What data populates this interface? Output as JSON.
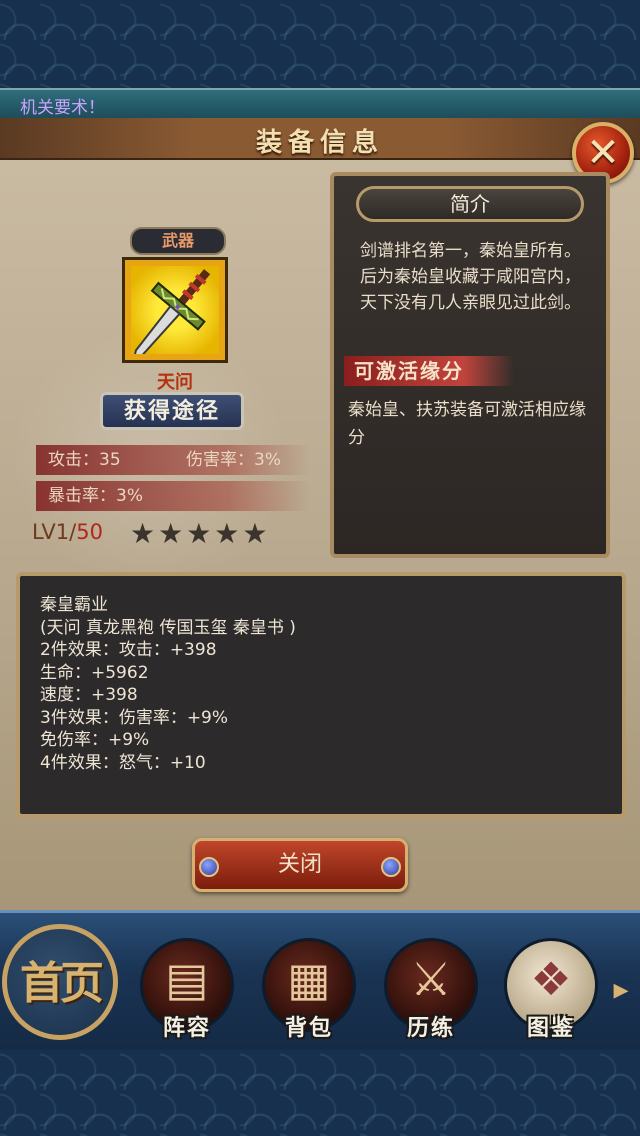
{
  "ticker": {
    "text": "机关要术！"
  },
  "dialog": {
    "title": "装备信息",
    "close_icon": "close-x-icon"
  },
  "item": {
    "category": "武器",
    "name": "天问",
    "icon": "sword-icon",
    "obtain_label": "获得途径",
    "stats": {
      "attack": "攻击：35",
      "damage_rate": "伤害率：3%",
      "crit_rate": "暴击率：3%"
    },
    "level_prefix": "LV1/",
    "level_max": "50",
    "stars": "★★★★★",
    "stars_filled": 0,
    "stars_total": 5
  },
  "intro": {
    "header": "简介",
    "text": "剑谱排名第一，秦始皇所有。后为秦始皇收藏于咸阳宫内，天下没有几人亲眼见过此剑。",
    "fate_title": "可激活缘分",
    "fate_text": "秦始皇、扶苏装备可激活相应缘分"
  },
  "set": {
    "lines": [
      "秦皇霸业",
      "(天问 真龙黑袍 传国玉玺 秦皇书 )",
      "2件效果：攻击：+398",
      "生命：+5962",
      "速度：+398",
      "3件效果：伤害率：+9%",
      "免伤率：+9%",
      "4件效果：怒气：+10"
    ]
  },
  "close_button": {
    "label": "关闭"
  },
  "nav": {
    "home": "首页",
    "items": [
      {
        "label": "阵容",
        "icon": "formation-icon"
      },
      {
        "label": "背包",
        "icon": "backpack-icon"
      },
      {
        "label": "历练",
        "icon": "swords-icon"
      },
      {
        "label": "图鉴",
        "icon": "scroll-icon"
      }
    ],
    "more_icon": "chevron-right-icon"
  },
  "colors": {
    "title_text": "#f3dfb0",
    "item_name": "#b5330c",
    "level_max": "#b3261a",
    "ticker_text": "#c9a2ff"
  }
}
